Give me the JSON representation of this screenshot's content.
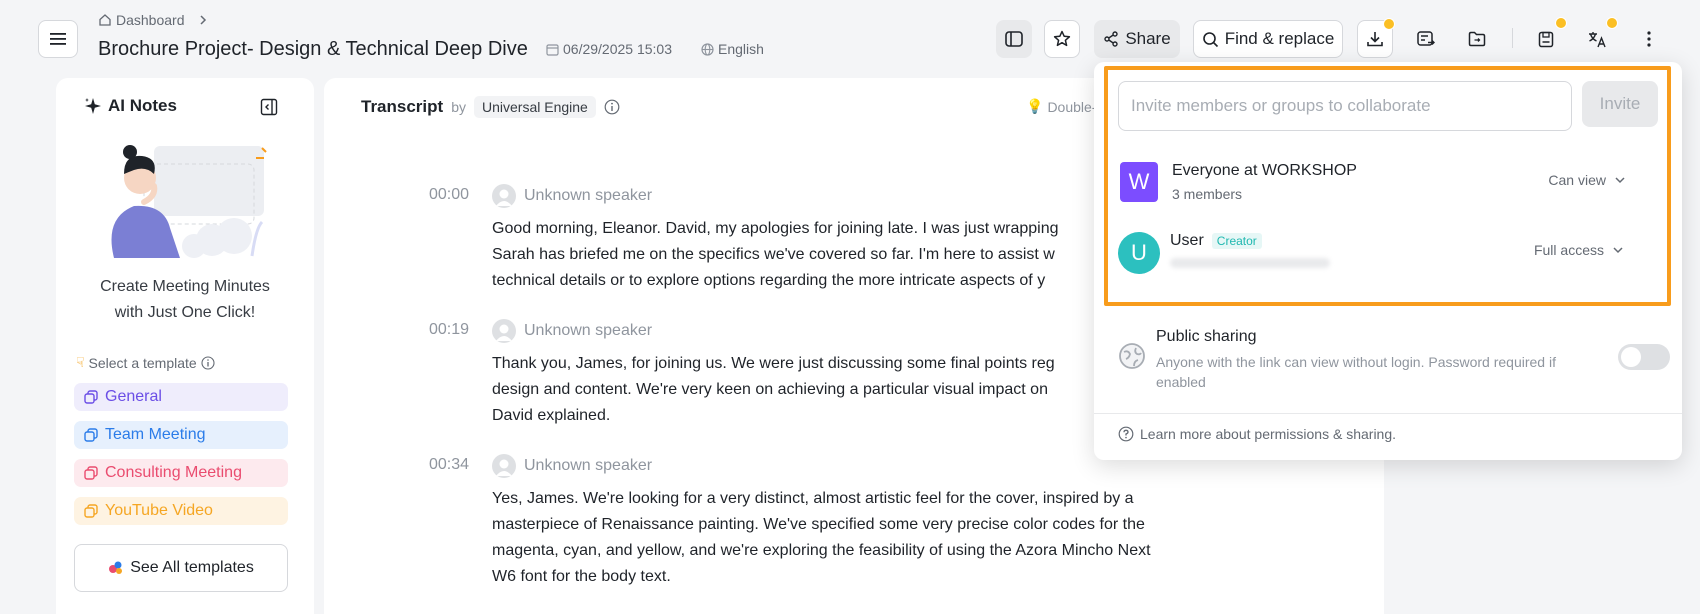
{
  "header": {
    "breadcrumb": "Dashboard",
    "title": "Brochure Project- Design & Technical Deep Dive",
    "date": "06/29/2025 15:03",
    "language": "English",
    "share_label": "Share",
    "find_replace_label": "Find & replace",
    "badge_color": "#fbbf24"
  },
  "ai_notes": {
    "title": "AI Notes",
    "cta_line1": "Create Meeting Minutes",
    "cta_line2": "with Just One Click!",
    "template_label": "Select a template",
    "templates": [
      {
        "label": "General",
        "color": "#6b4ee6",
        "bg": "#efedfc"
      },
      {
        "label": "Team Meeting",
        "color": "#2b7ce9",
        "bg": "#e6f0fd"
      },
      {
        "label": "Consulting Meeting",
        "color": "#ea4c6f",
        "bg": "#fdeaee"
      },
      {
        "label": "YouTube Video",
        "color": "#f5a623",
        "bg": "#fef3e2"
      }
    ],
    "see_all_label": "See All templates"
  },
  "transcript": {
    "title": "Transcript",
    "by": "by",
    "engine": "Universal Engine",
    "hint": "Double-",
    "segments": [
      {
        "time": "00:00",
        "speaker": "Unknown speaker",
        "lines": [
          "Good morning, Eleanor. David, my apologies for joining late. I was just wrapping",
          "Sarah has briefed me on the specifics we've covered so far. I'm here to assist w",
          "technical details or to explore options regarding the more intricate aspects of y"
        ]
      },
      {
        "time": "00:19",
        "speaker": "Unknown speaker",
        "lines": [
          "Thank you, James, for joining us. We were just discussing some final points reg",
          "design and content. We're very keen on achieving a particular visual impact on",
          "David explained."
        ]
      },
      {
        "time": "00:34",
        "speaker": "Unknown speaker",
        "lines": [
          "Yes, James. We're looking for a very distinct, almost artistic feel for the cover, inspired by a",
          "masterpiece of Renaissance painting. We've specified some very precise color codes for the",
          "magenta, cyan, and yellow, and we're exploring the feasibility of using the Azora Mincho Next",
          "W6 font for the body text."
        ]
      }
    ]
  },
  "share_popover": {
    "invite_placeholder": "Invite members or groups to collaborate",
    "invite_label": "Invite",
    "highlight_color": "#f89c1c",
    "members": [
      {
        "initial": "W",
        "name": "Everyone at WORKSHOP",
        "sub": "3 members",
        "permission": "Can view",
        "color": "#7c4dff"
      },
      {
        "initial": "U",
        "name": "User",
        "tag": "Creator",
        "permission": "Full access",
        "color": "#2cc0bf"
      }
    ],
    "public_title": "Public sharing",
    "public_desc": "Anyone with the link can view without login. Password required if enabled",
    "public_enabled": false,
    "learn_more": "Learn more about permissions & sharing."
  }
}
